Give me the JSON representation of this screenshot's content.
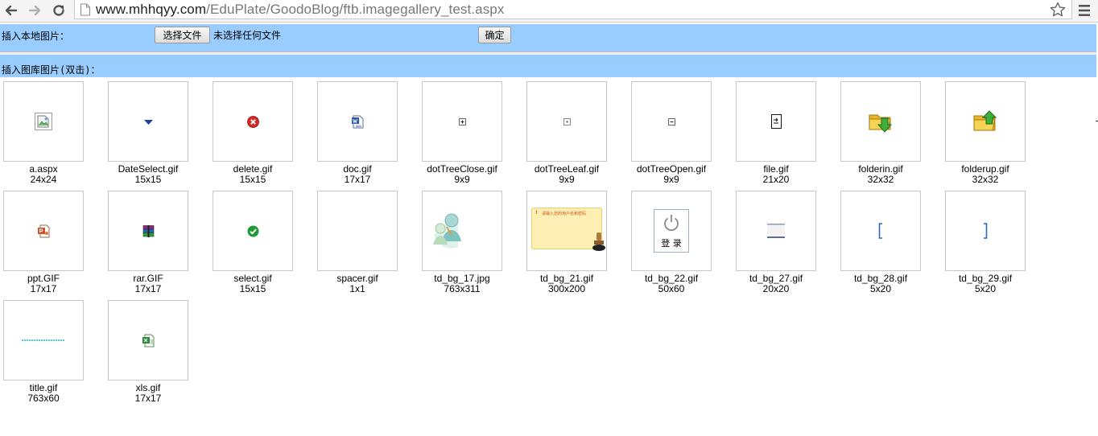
{
  "browser": {
    "url_host": "www.mhhqyy.com",
    "url_path": "/EduPlate/GoodoBlog/ftb.imagegallery_test.aspx",
    "icons": [
      "back-icon",
      "forward-icon",
      "reload-icon",
      "page-icon",
      "star-icon",
      "menu-icon"
    ]
  },
  "upload": {
    "label": "插入本地图片：",
    "choose_button": "选择文件",
    "no_file_text": "未选择任何文件",
    "confirm_button": "确定"
  },
  "gallery": {
    "label": "插入图库图片(双击)：",
    "items": [
      {
        "name": "a.aspx",
        "size": "24x24",
        "icon": "broken-image-icon"
      },
      {
        "name": "DateSelect.gif",
        "size": "15x15",
        "icon": "dropdown-arrow-icon"
      },
      {
        "name": "delete.gif",
        "size": "15x15",
        "icon": "delete-icon"
      },
      {
        "name": "doc.gif",
        "size": "17x17",
        "icon": "word-doc-icon"
      },
      {
        "name": "dotTreeClose.gif",
        "size": "9x9",
        "icon": "tree-plus-icon"
      },
      {
        "name": "dotTreeLeaf.gif",
        "size": "9x9",
        "icon": "tree-leaf-icon"
      },
      {
        "name": "dotTreeOpen.gif",
        "size": "9x9",
        "icon": "tree-minus-icon"
      },
      {
        "name": "file.gif",
        "size": "21x20",
        "icon": "file-icon"
      },
      {
        "name": "folderin.gif",
        "size": "32x32",
        "icon": "folder-in-icon"
      },
      {
        "name": "folderup.gif",
        "size": "32x32",
        "icon": "folder-up-icon"
      },
      {
        "name": "ppt.GIF",
        "size": "17x17",
        "icon": "ppt-icon"
      },
      {
        "name": "rar.GIF",
        "size": "17x17",
        "icon": "rar-icon"
      },
      {
        "name": "select.gif",
        "size": "15x15",
        "icon": "check-icon"
      },
      {
        "name": "spacer.gif",
        "size": "1x1",
        "icon": "spacer-icon"
      },
      {
        "name": "td_bg_17.jpg",
        "size": "763x311",
        "icon": "users-illustration-icon"
      },
      {
        "name": "td_bg_21.gif",
        "size": "300x200",
        "icon": "login-notice-icon",
        "notice_text": "请输入您的用户名和密码"
      },
      {
        "name": "td_bg_22.gif",
        "size": "50x60",
        "icon": "power-login-icon",
        "label": "登 录"
      },
      {
        "name": "td_bg_27.gif",
        "size": "20x20",
        "icon": "bar-image-icon"
      },
      {
        "name": "td_bg_28.gif",
        "size": "5x20",
        "icon": "left-bracket-image-icon"
      },
      {
        "name": "td_bg_29.gif",
        "size": "5x20",
        "icon": "right-bracket-image-icon"
      },
      {
        "name": "title.gif",
        "size": "763x60",
        "icon": "title-strip-icon"
      },
      {
        "name": "xls.gif",
        "size": "17x17",
        "icon": "excel-icon"
      }
    ]
  },
  "colors": {
    "bar_bg": "#99ccff",
    "thumb_border": "#c8c8c8"
  }
}
